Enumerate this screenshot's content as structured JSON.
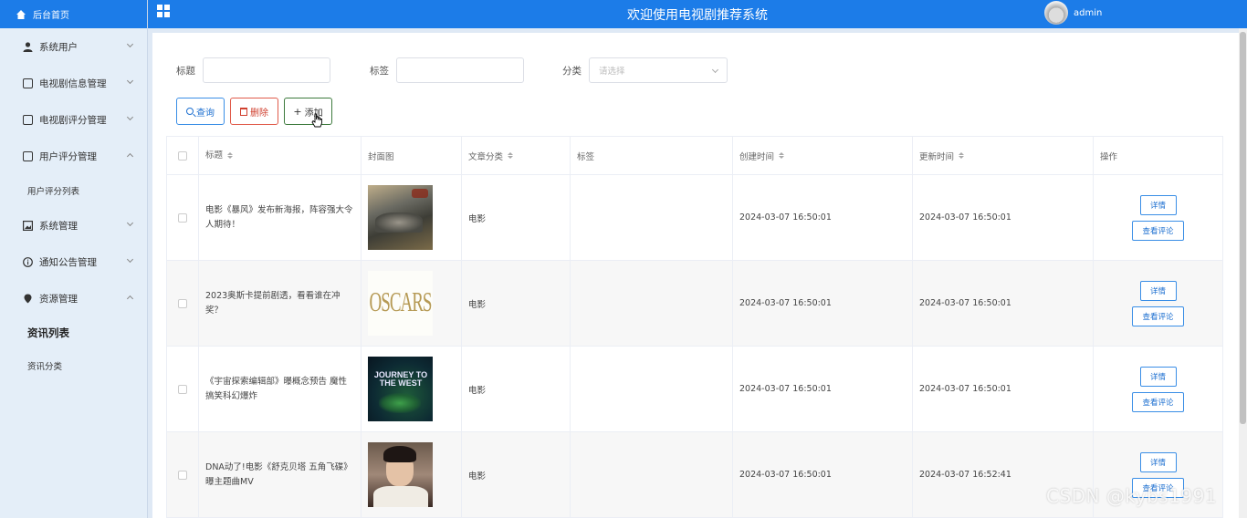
{
  "header": {
    "title": "欢迎使用电视剧推荐系统",
    "username": "admin"
  },
  "sidebar": {
    "home": "后台首页",
    "items": [
      {
        "label": "系统用户"
      },
      {
        "label": "电视剧信息管理"
      },
      {
        "label": "电视剧评分管理"
      },
      {
        "label": "用户评分管理",
        "sub": [
          "用户评分列表"
        ]
      },
      {
        "label": "系统管理"
      },
      {
        "label": "通知公告管理"
      },
      {
        "label": "资源管理",
        "sub": [
          "资讯列表",
          "资讯分类"
        ]
      }
    ]
  },
  "filters": {
    "title_label": "标题",
    "tag_label": "标签",
    "category_label": "分类",
    "category_placeholder": "请选择"
  },
  "toolbar": {
    "search": "查询",
    "delete": "删除",
    "add": "添加"
  },
  "table": {
    "columns": [
      "标题",
      "封面图",
      "文章分类",
      "标签",
      "创建时间",
      "更新时间",
      "操作"
    ],
    "rows": [
      {
        "title": "电影《暴风》发布新海报，阵容强大令人期待！",
        "category": "电影",
        "tag": "",
        "created": "2024-03-07 16:50:01",
        "updated": "2024-03-07 16:50:01"
      },
      {
        "title": "2023奥斯卡提前剧透，看看谁在冲奖？",
        "category": "电影",
        "tag": "",
        "created": "2024-03-07 16:50:01",
        "updated": "2024-03-07 16:50:01",
        "cover_text": "OSCARS"
      },
      {
        "title": "《宇宙探索编辑部》曝概念预告 魔性搞笑科幻爆炸",
        "category": "电影",
        "tag": "",
        "created": "2024-03-07 16:50:01",
        "updated": "2024-03-07 16:50:01",
        "cover_text": "JOURNEY TO THE WEST"
      },
      {
        "title": "DNA动了!电影《舒克贝塔 五角飞碟》曝主题曲MV",
        "category": "电影",
        "tag": "",
        "created": "2024-03-07 16:50:01",
        "updated": "2024-03-07 16:52:41"
      }
    ],
    "detail_label": "详情",
    "comments_label": "查看评论"
  },
  "watermark": "CSDN @kybs1991",
  "colors": {
    "primary": "#1c7ce8",
    "danger": "#d0402f",
    "sidebar_bg": "#e4eef8"
  }
}
